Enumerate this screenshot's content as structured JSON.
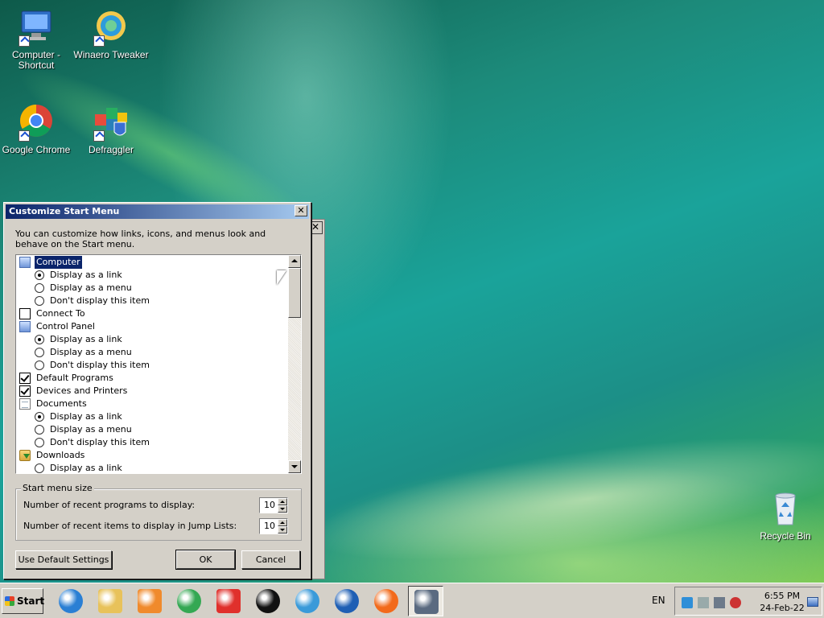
{
  "desktop": {
    "icons": [
      {
        "label": "Computer - Shortcut",
        "icon": "computer-icon"
      },
      {
        "label": "Winaero Tweaker",
        "icon": "winaero-tweaker-icon"
      },
      {
        "label": "Google Chrome",
        "icon": "chrome-icon"
      },
      {
        "label": "Defraggler",
        "icon": "defraggler-icon"
      },
      {
        "label": "Recycle Bin",
        "icon": "recycle-bin-icon"
      }
    ]
  },
  "dialog": {
    "title": "Customize Start Menu",
    "close_glyph": "✕",
    "description": "You can customize how links, icons, and menus look and behave on the Start menu.",
    "list_items": [
      {
        "type": "header",
        "icon": "computer-icon",
        "label": "Computer",
        "selected": true
      },
      {
        "type": "radio",
        "label": "Display as a link",
        "checked": true
      },
      {
        "type": "radio",
        "label": "Display as a menu",
        "checked": false
      },
      {
        "type": "radio",
        "label": "Don't display this item",
        "checked": false
      },
      {
        "type": "checkbox",
        "label": "Connect To",
        "checked": false
      },
      {
        "type": "header",
        "icon": "control-panel-icon",
        "label": "Control Panel"
      },
      {
        "type": "radio",
        "label": "Display as a link",
        "checked": true
      },
      {
        "type": "radio",
        "label": "Display as a menu",
        "checked": false
      },
      {
        "type": "radio",
        "label": "Don't display this item",
        "checked": false
      },
      {
        "type": "checkbox",
        "label": "Default Programs",
        "checked": true
      },
      {
        "type": "checkbox",
        "label": "Devices and Printers",
        "checked": true
      },
      {
        "type": "header",
        "icon": "documents-icon",
        "label": "Documents"
      },
      {
        "type": "radio",
        "label": "Display as a link",
        "checked": true
      },
      {
        "type": "radio",
        "label": "Display as a menu",
        "checked": false
      },
      {
        "type": "radio",
        "label": "Don't display this item",
        "checked": false
      },
      {
        "type": "header",
        "icon": "downloads-icon",
        "label": "Downloads"
      },
      {
        "type": "radio",
        "label": "Display as a link",
        "checked": false
      }
    ],
    "size_group": {
      "legend": "Start menu size",
      "recent_programs_label": "Number of recent programs to display:",
      "recent_programs_value": "10",
      "recent_items_label": "Number of recent items to display in Jump Lists:",
      "recent_items_value": "10"
    },
    "buttons": {
      "defaults": "Use Default Settings",
      "ok": "OK",
      "cancel": "Cancel"
    }
  },
  "back_dialog": {
    "close_glyph": "✕"
  },
  "taskbar": {
    "start_label": "Start",
    "apps": [
      {
        "name": "internet-explorer",
        "color": "#2a7fd4"
      },
      {
        "name": "file-explorer",
        "color": "#e8c25a"
      },
      {
        "name": "media-player",
        "color": "#f08a2c"
      },
      {
        "name": "chrome",
        "color": "#34a853"
      },
      {
        "name": "vivaldi",
        "color": "#e0302c"
      },
      {
        "name": "recorder",
        "color": "#111111"
      },
      {
        "name": "winaero-tweaker",
        "color": "#3a9ad9"
      },
      {
        "name": "seamonkey",
        "color": "#1f5fb4"
      },
      {
        "name": "firefox",
        "color": "#f26a1b"
      },
      {
        "name": "server-manager",
        "color": "#5a6a80"
      }
    ],
    "language": "EN",
    "time": "6:55 PM",
    "date": "24-Feb-22"
  }
}
